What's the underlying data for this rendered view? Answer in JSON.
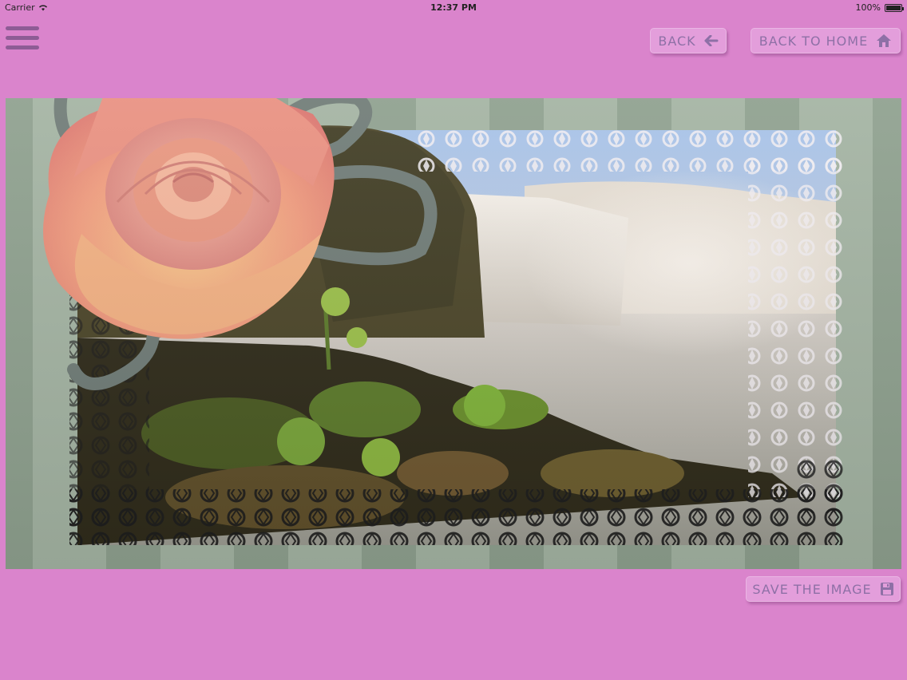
{
  "status_bar": {
    "carrier": "Carrier",
    "time": "12:37 PM",
    "battery": "100%"
  },
  "header": {
    "back_label": "BACK",
    "home_label": "BACK TO HOME"
  },
  "footer": {
    "save_label": "SAVE THE IMAGE"
  },
  "icons": {
    "menu": "hamburger-menu-icon",
    "back": "arrow-left-icon",
    "home": "home-icon",
    "save": "floppy-disk-icon"
  },
  "colors": {
    "background": "#da84cc",
    "button": "#e39edb",
    "button_text": "#8e70a6",
    "menu_bars": "#8e5c95"
  }
}
